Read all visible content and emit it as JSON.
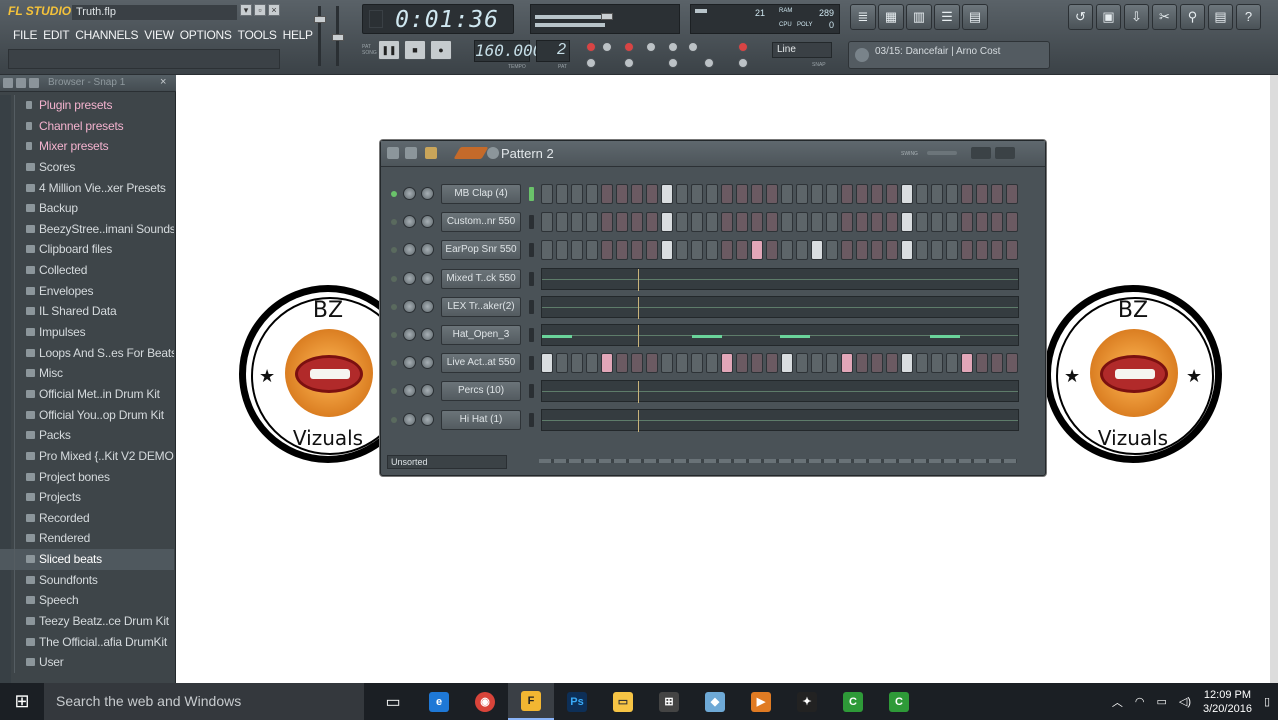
{
  "app": {
    "logo": "FL STUDIO",
    "project": "Truth.flp"
  },
  "menu": [
    "FILE",
    "EDIT",
    "CHANNELS",
    "VIEW",
    "OPTIONS",
    "TOOLS",
    "HELP"
  ],
  "transport": {
    "time": "0:01:36",
    "tempo": "160.000",
    "pattern": "2",
    "tempo_label": "TEMPO",
    "pat_label": "PAT",
    "snap": "Line",
    "snap_label": "SNAP"
  },
  "monitor": {
    "cpu_label": "CPU",
    "ram_label": "RAM",
    "poly_label": "POLY",
    "value1": "21",
    "value2": "289",
    "value3": "0"
  },
  "song": {
    "title": "03/15: Dancefair | Arno Cost"
  },
  "browser": {
    "title": "Browser - Snap 1",
    "items": [
      {
        "label": "Plugin presets",
        "kind": "preset"
      },
      {
        "label": "Channel presets",
        "kind": "preset"
      },
      {
        "label": "Mixer presets",
        "kind": "preset"
      },
      {
        "label": "Scores",
        "kind": "folder"
      },
      {
        "label": "4 Million Vie..xer Presets",
        "kind": "folder"
      },
      {
        "label": "Backup",
        "kind": "folder"
      },
      {
        "label": "BeezyStree..imani Sounds",
        "kind": "folder"
      },
      {
        "label": "Clipboard files",
        "kind": "folder"
      },
      {
        "label": "Collected",
        "kind": "folder"
      },
      {
        "label": "Envelopes",
        "kind": "folder"
      },
      {
        "label": "IL Shared Data",
        "kind": "folder"
      },
      {
        "label": "Impulses",
        "kind": "folder"
      },
      {
        "label": "Loops And S..es For Beats",
        "kind": "folder"
      },
      {
        "label": "Misc",
        "kind": "folder"
      },
      {
        "label": "Official Met..in Drum Kit",
        "kind": "folder"
      },
      {
        "label": "Official You..op Drum Kit",
        "kind": "folder"
      },
      {
        "label": "Packs",
        "kind": "folder"
      },
      {
        "label": "Pro Mixed {..Kit V2 DEMO",
        "kind": "folder"
      },
      {
        "label": "Project bones",
        "kind": "folder"
      },
      {
        "label": "Projects",
        "kind": "folder"
      },
      {
        "label": "Recorded",
        "kind": "folder"
      },
      {
        "label": "Rendered",
        "kind": "folder"
      },
      {
        "label": "Sliced beats",
        "kind": "selected"
      },
      {
        "label": "Soundfonts",
        "kind": "folder"
      },
      {
        "label": "Speech",
        "kind": "folder"
      },
      {
        "label": "Teezy Beatz..ce Drum Kit",
        "kind": "folder"
      },
      {
        "label": "The Official..afia DrumKit",
        "kind": "folder"
      },
      {
        "label": "User",
        "kind": "folder"
      }
    ]
  },
  "badge": {
    "top": "BZ",
    "bottom": "Vizuals"
  },
  "channel_rack": {
    "title": "Pattern 2",
    "swing_label": "SWING",
    "filter": "Unsorted",
    "channels": [
      {
        "name": "MB Clap (4)",
        "type": "steps",
        "on": [
          8,
          24
        ]
      },
      {
        "name": "Custom..nr 550",
        "type": "steps",
        "on": [
          8,
          24
        ]
      },
      {
        "name": "EarPop Snr 550",
        "type": "steps",
        "on": [
          8,
          14,
          18,
          24
        ],
        "pink": [
          14
        ]
      },
      {
        "name": "Mixed T..ck 550",
        "type": "roll"
      },
      {
        "name": "LEX Tr..aker(2)",
        "type": "roll"
      },
      {
        "name": "Hat_Open_3",
        "type": "roll"
      },
      {
        "name": "Live Act..at 550",
        "type": "steps",
        "on": [
          0,
          4,
          12,
          16,
          20,
          24,
          28
        ],
        "pink": [
          4,
          12,
          20,
          28
        ]
      },
      {
        "name": "Percs (10)",
        "type": "roll"
      },
      {
        "name": "Hi Hat (1)",
        "type": "roll"
      }
    ]
  },
  "taskbar": {
    "search": "Search the web and Windows",
    "time": "12:09 PM",
    "date": "3/20/2016"
  }
}
